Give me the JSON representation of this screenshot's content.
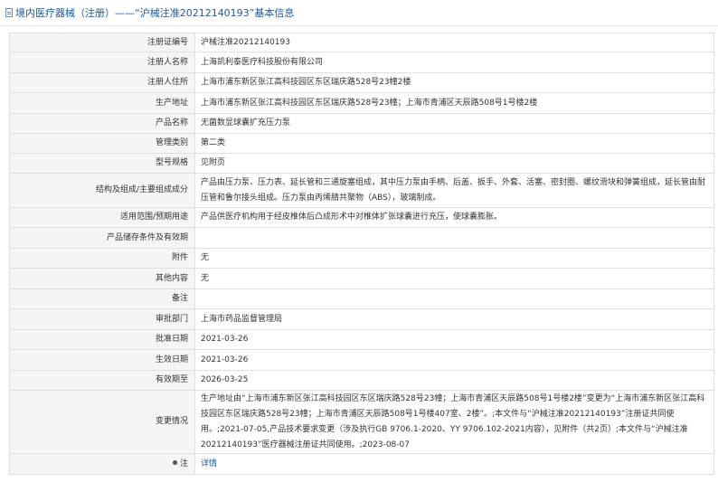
{
  "header": {
    "title": "境内医疗器械（注册）——“沪械注准20212140193”基本信息"
  },
  "rows": [
    {
      "label": "注册证编号",
      "value": "沪械注准20212140193"
    },
    {
      "label": "注册人名称",
      "value": "上海凯利泰医疗科技股份有限公司"
    },
    {
      "label": "注册人住所",
      "value": "上海市浦东新区张江高科技园区东区瑞庆路528号23幢2楼"
    },
    {
      "label": "生产地址",
      "value": "上海市浦东新区张江高科技园区东区瑞庆路528号23幢；上海市青浦区天辰路508号1号楼2楼"
    },
    {
      "label": "产品名称",
      "value": "无菌数显球囊扩充压力泵"
    },
    {
      "label": "管理类别",
      "value": "第二类"
    },
    {
      "label": "型号规格",
      "value": "见附页"
    },
    {
      "label": "结构及组成/主要组成成分",
      "value": "产品由压力泵、压力表、延长管和三通旋塞组成，其中压力泵由手柄、后盖、扳手、外套、活塞、密封圈、螺纹滑块和弹簧组成，延长管由耐压管和鲁尔接头组成。压力泵由丙烯腈共聚物（ABS），玻璃制成。"
    },
    {
      "label": "适用范围/预期用途",
      "value": "产品供医疗机构用于经皮椎体后凸成形术中对椎体扩张球囊进行充压，使球囊膨胀。"
    },
    {
      "label": "产品储存条件及有效期",
      "value": ""
    },
    {
      "label": "附件",
      "value": "无"
    },
    {
      "label": "其他内容",
      "value": "无"
    },
    {
      "label": "备注",
      "value": ""
    },
    {
      "label": "审批部门",
      "value": "上海市药品监督管理局"
    },
    {
      "label": "批准日期",
      "value": "2021-03-26"
    },
    {
      "label": "生效日期",
      "value": "2021-03-26"
    },
    {
      "label": "有效期至",
      "value": "2026-03-25"
    },
    {
      "label": "变更情况",
      "value": "生产地址由“上海市浦东新区张江高科技园区东区瑞庆路528号23幢；上海市青浦区天辰路508号1号楼2楼”变更为“上海市浦东新区张江高科技园区东区瑞庆路528号23幢；上海市青浦区天辰路508号1号楼407室、2楼”。;本文件与“沪械注准20212140193”注册证共同使用。;2021-07-05,产品技术要求变更（涉及执行GB 9706.1-2020、YY 9706.102-2021内容），见附件（共2页）;本文件与“沪械注准20212140193”医疗器械注册证共同使用。;2023-08-07"
    }
  ],
  "footer_row": {
    "label": "注",
    "link_label": "详情",
    "icon": "pin-icon"
  }
}
